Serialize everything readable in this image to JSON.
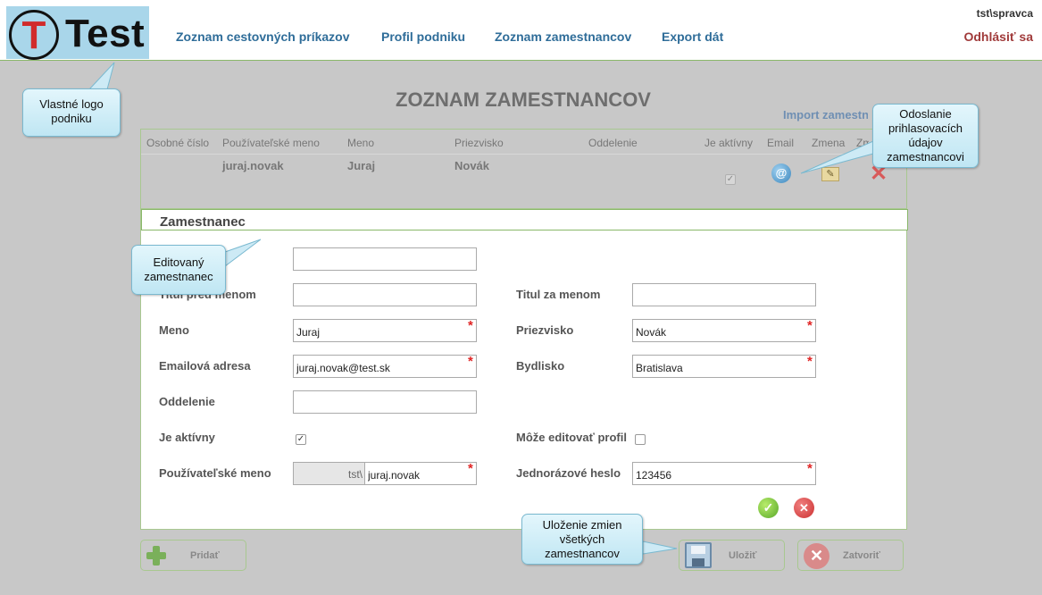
{
  "header": {
    "logo": {
      "letter": "T",
      "word": "Test"
    },
    "nav": [
      {
        "label": "Zoznam cestovných príkazov"
      },
      {
        "label": "Profil podniku"
      },
      {
        "label": "Zoznam zamestnancov"
      },
      {
        "label": "Export dát"
      }
    ],
    "user": "tst\\spravca",
    "logout": "Odhlásiť sa"
  },
  "page_title": "ZOZNAM ZAMESTNANCOV",
  "import_link": "Import zamestnancov",
  "grid": {
    "columns": [
      "Osobné číslo",
      "Používateľské meno",
      "Meno",
      "Priezvisko",
      "Oddelenie",
      "Je aktívny",
      "Email",
      "Zmena",
      "Zmazať"
    ],
    "rows": [
      {
        "osobne_cislo": "",
        "username": "juraj.novak",
        "meno": "Juraj",
        "priezvisko": "Novák",
        "oddelenie": "",
        "active_mark": "✓"
      }
    ],
    "icons": {
      "email": "@",
      "edit": "✎",
      "delete": "✕"
    }
  },
  "panel": {
    "title": "Zamestnanec",
    "fields": {
      "osobne_cislo": {
        "value": ""
      },
      "titul_pred": {
        "label": "Titul pred menom",
        "value": ""
      },
      "titul_za": {
        "label": "Titul za menom",
        "value": ""
      },
      "meno": {
        "label": "Meno",
        "value": "Juraj"
      },
      "priezvisko": {
        "label": "Priezvisko",
        "value": "Novák"
      },
      "email": {
        "label": "Emailová adresa",
        "value": "juraj.novak@test.sk"
      },
      "bydlisko": {
        "label": "Bydlisko",
        "value": "Bratislava"
      },
      "oddelenie": {
        "label": "Oddelenie",
        "value": ""
      },
      "je_aktivny": {
        "label": "Je aktívny",
        "mark": "✓"
      },
      "moze_editovat": {
        "label": "Môže editovať profil",
        "mark": ""
      },
      "username": {
        "label": "Používateľské meno",
        "prefix": "tst\\",
        "value": "juraj.novak"
      },
      "heslo": {
        "label": "Jednorázové heslo",
        "value": "123456"
      }
    },
    "required_mark": "*",
    "ok_glyph": "✓",
    "cancel_glyph": "✕"
  },
  "buttons": {
    "add": "Pridať",
    "save": "Uložiť",
    "close": "Zatvoriť",
    "close_glyph": "✕"
  },
  "callouts": {
    "logo": "Vlastné logo podniku",
    "email": "Odoslanie prihlasovacích údajov zamestnancovi",
    "edited": "Editovaný zamestnanec",
    "save": "Uloženie zmien všetkých zamestnancov"
  },
  "colors": {
    "nav": "#2f6d99",
    "logout": "#a03a3a",
    "required": "#e02424",
    "accent_border": "#8ab86a",
    "callout_bg": "#d5eff8"
  }
}
